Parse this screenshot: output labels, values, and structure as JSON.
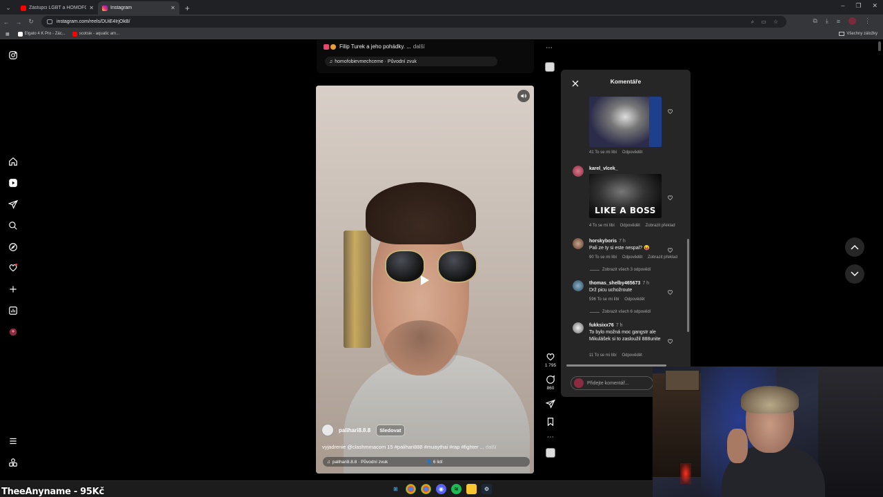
{
  "browser": {
    "tabs": [
      {
        "label": "Zástupci LGBT a HOMOFÓBOVÉ",
        "fav_color": "#ff0000",
        "active": false
      },
      {
        "label": "Instagram",
        "fav_color": "#d62976",
        "active": true
      }
    ],
    "url": "instagram.com/reels/DUiE4IrjOkB/",
    "bookmarks": [
      {
        "label": "Elgato 4 K Pro - Zác...",
        "color": "#ffffff"
      },
      {
        "label": "scotsie - aquatic am...",
        "color": "#ff0000"
      }
    ],
    "bookmarks_right": "Všechny záložky"
  },
  "nav": {
    "items": [
      "instagram-logo-icon",
      "home-icon",
      "reels-icon",
      "messages-icon",
      "search-icon",
      "explore-icon",
      "notifications-icon",
      "create-icon",
      "dashboard-icon",
      "profile-avatar",
      "menu-icon",
      "threads-icon"
    ]
  },
  "prev_reel": {
    "caption": "Filip Turek a jeho pohádky. ...",
    "more": "další",
    "audio": "homofobievmechceme · Původní zvuk"
  },
  "reel": {
    "author": "palihari8.8.8",
    "follow_label": "Sledovat",
    "caption": "vyjadrenie @clashmmacom 15 #palihari888 #muaythai #rap #fighter ...",
    "more": "další",
    "audio": "palihari8.8.8 · Původní zvuk",
    "people": "6 lidí"
  },
  "actions": {
    "likes": "1 795",
    "comments": "860"
  },
  "comments_panel": {
    "title": "Komentáře",
    "gif1_meta": {
      "likes": "41 To se mi líbí",
      "reply": "Odpovědět"
    },
    "c2": {
      "user": "karel_vlcek_",
      "gif_text": "LIKE A BOSS",
      "likes": "4 To se mi líbí",
      "reply": "Odpovědět",
      "translate": "Zobrazit překlad"
    },
    "c3": {
      "user": "horskyboris",
      "time": "7 h",
      "text": "Pali ze ty si este nespal? 😝",
      "likes": "90 To se mi líbí",
      "reply": "Odpovědět",
      "translate": "Zobrazit překlad",
      "replies": "Zobrazit všech 3 odpovědí"
    },
    "c4": {
      "user": "thomas_shelby465673",
      "time": "7 h",
      "text": "Drž picu uchožroute",
      "likes": "596 To se mi líbí",
      "reply": "Odpovědět",
      "replies": "Zobrazit všech 6 odpovědí"
    },
    "c5": {
      "user": "fukksixx76",
      "time": "7 h",
      "text": "To bylo možná moc gangstr ale Mikulášek si to zasloužil 888unite",
      "likes": "11 To se mi líbí",
      "reply": "Odpovědět"
    },
    "input_placeholder": "Přidejte komentář..."
  },
  "stream": {
    "name": "TheeAnyname - 95Kč"
  },
  "colors": {
    "accent": "#0095f6",
    "panel": "#262626"
  }
}
